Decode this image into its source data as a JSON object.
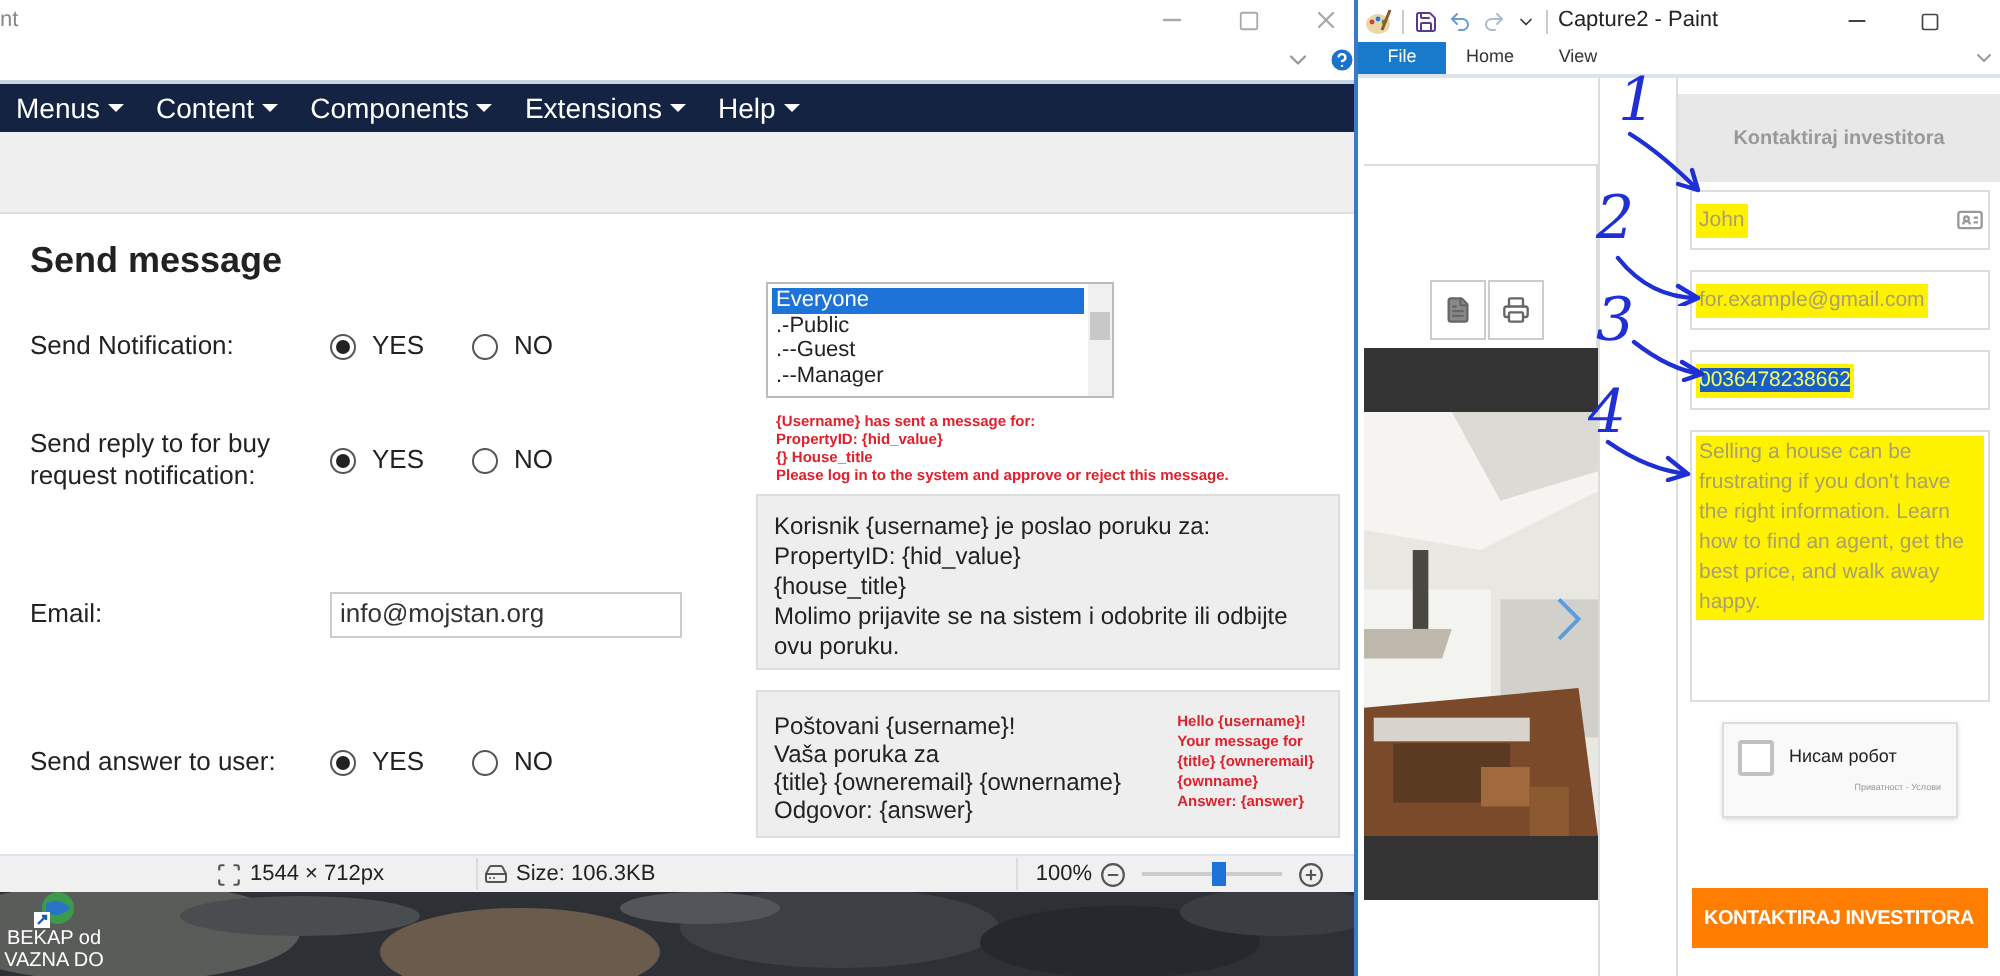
{
  "left_window": {
    "title": "nt",
    "menu": [
      {
        "label": "Menus"
      },
      {
        "label": "Content"
      },
      {
        "label": "Components"
      },
      {
        "label": "Extensions"
      },
      {
        "label": "Help"
      }
    ],
    "heading": "Send message",
    "form_rows": [
      {
        "kind": "radio",
        "label": "Send Notification:",
        "options": [
          {
            "label": "YES",
            "selected": true
          },
          {
            "label": "NO",
            "selected": false
          }
        ]
      },
      {
        "kind": "radio",
        "label": "Send reply to for buy request notification:",
        "options": [
          {
            "label": "YES",
            "selected": true
          },
          {
            "label": "NO",
            "selected": false
          }
        ]
      },
      {
        "kind": "input",
        "label": "Email:",
        "value": "info@mojstan.org"
      },
      {
        "kind": "radio",
        "label": "Send answer to user:",
        "options": [
          {
            "label": "YES",
            "selected": true
          },
          {
            "label": "NO",
            "selected": false
          }
        ]
      }
    ],
    "group_list": [
      {
        "label": "Everyone",
        "selected": true
      },
      {
        "label": ".-Public",
        "selected": false
      },
      {
        "label": ".--Guest",
        "selected": false
      },
      {
        "label": ".--Manager",
        "selected": false
      }
    ],
    "admin_note": [
      "{Username} has sent a message for:",
      "PropertyID: {hid_value}",
      "{} House_title",
      "Please log in to the system and approve or reject this message."
    ],
    "admin_template": [
      "Korisnik {username} je poslao poruku za:",
      "PropertyID: {hid_value}",
      "{house_title}",
      "Molimo prijavite se na sistem i odobrite ili odbijte ovu poruku."
    ],
    "user_template": [
      "Poštovani {username}!",
      "Vaša poruka za",
      "{title} {owneremail} {ownername}",
      "Odgovor: {answer}"
    ],
    "user_note": [
      "Hello {username}!",
      "Your message for",
      "{title} {owneremail}",
      "{ownname}",
      "Answer: {answer}"
    ],
    "status_bar": {
      "dimensions": "1544 × 712px",
      "size": "Size: 106.3KB",
      "zoom": "100%",
      "zoom_slider": {
        "level": 0.55
      }
    }
  },
  "desktop_icon": {
    "label_lines": [
      "BEKAP od",
      "VAZNA DO"
    ]
  },
  "right_window": {
    "title": "Capture2 - Paint",
    "tabs": [
      {
        "label": "File",
        "selected": true
      },
      {
        "label": "Home",
        "selected": false
      },
      {
        "label": "View",
        "selected": false
      }
    ],
    "contact_form": {
      "header": "Kontaktiraj investitora",
      "fields": [
        {
          "kind": "input",
          "value": "John",
          "highlighted": true,
          "text_selected": false
        },
        {
          "kind": "input",
          "value": "for.example@gmail.com",
          "highlighted": true,
          "text_selected": false
        },
        {
          "kind": "input",
          "value": "0036478238662",
          "highlighted": true,
          "text_selected": true
        },
        {
          "kind": "textarea",
          "value": "Selling a house can be frustrating if you don't have the right information. Learn how to find an agent, get the best price, and walk away happy.",
          "highlighted": true,
          "text_selected": false
        }
      ],
      "captcha": {
        "label": "Нисам робот",
        "checked": false,
        "footer": "Приватност - Услови"
      },
      "submit": "KONTAKTIRAJ INVESTITORA"
    },
    "annotations": [
      {
        "label": "1"
      },
      {
        "label": "2"
      },
      {
        "label": "3"
      },
      {
        "label": "4"
      }
    ]
  }
}
